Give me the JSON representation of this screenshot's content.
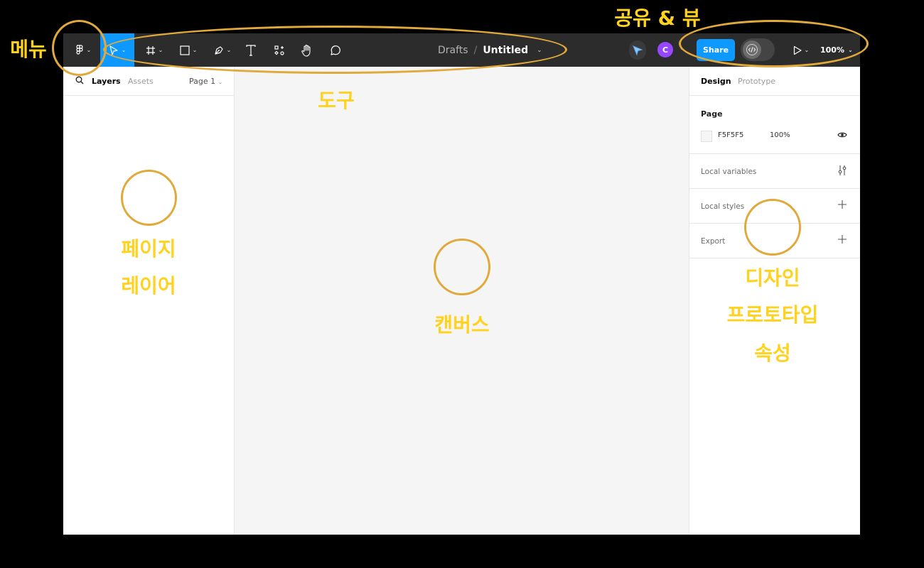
{
  "toolbar": {
    "breadcrumb_drafts": "Drafts",
    "breadcrumb_separator": "/",
    "file_title": "Untitled",
    "share_label": "Share",
    "avatar_initial": "C",
    "zoom_label": "100%",
    "icons": [
      "figma-menu-icon",
      "move-tool-icon",
      "frame-tool-icon",
      "shape-tool-icon",
      "pen-tool-icon",
      "text-tool-icon",
      "resources-icon",
      "hand-tool-icon",
      "comment-tool-icon",
      "multiplayer-cursor-icon",
      "dev-mode-icon",
      "present-icon"
    ]
  },
  "left_panel": {
    "tab_layers": "Layers",
    "tab_assets": "Assets",
    "page_selector": "Page 1"
  },
  "right_panel": {
    "tab_design": "Design",
    "tab_prototype": "Prototype",
    "page_section": {
      "label": "Page",
      "color_hex": "F5F5F5",
      "opacity": "100%"
    },
    "local_variables": "Local variables",
    "local_styles": "Local styles",
    "export": "Export"
  },
  "annotations": {
    "menu": "메뉴",
    "tools": "도구",
    "share_view": "공유 & 뷰",
    "left_line1": "페이지",
    "left_line2": "레이어",
    "canvas": "캔버스",
    "right_line1": "디자인",
    "right_line2": "프로토타입",
    "right_line3": "속성"
  },
  "colors": {
    "toolbar_bg": "#2c2c2c",
    "accent_blue": "#0d99ff",
    "canvas_bg": "#f5f5f5",
    "annotation_stroke": "#e0a93a",
    "annotation_text": "#ffd21f",
    "avatar_purple": "#9747ff"
  }
}
